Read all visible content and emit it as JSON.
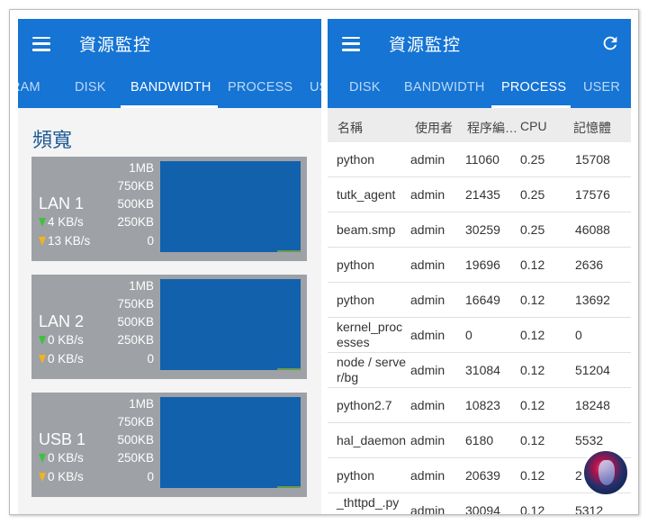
{
  "app": {
    "title": "資源監控"
  },
  "left": {
    "tabs": [
      "RAM",
      "DISK",
      "BANDWIDTH",
      "PROCESS",
      "USER"
    ],
    "active_tab": "BANDWIDTH",
    "section_title": "頻寬",
    "scale_labels": [
      "1MB",
      "750KB",
      "500KB",
      "250KB",
      "0"
    ],
    "interfaces": [
      {
        "name": "LAN 1",
        "upload": "4 KB/s",
        "download": "13 KB/s"
      },
      {
        "name": "LAN 2",
        "upload": "0 KB/s",
        "download": "0 KB/s"
      },
      {
        "name": "USB 1",
        "upload": "0 KB/s",
        "download": "0 KB/s"
      }
    ]
  },
  "right": {
    "tabs": [
      "DISK",
      "BANDWIDTH",
      "PROCESS",
      "USER"
    ],
    "active_tab": "PROCESS",
    "columns": [
      "名稱",
      "使用者",
      "程序編…",
      "CPU",
      "記憶體"
    ],
    "rows": [
      [
        "python",
        "admin",
        "11060",
        "0.25",
        "15708"
      ],
      [
        "tutk_agent",
        "admin",
        "21435",
        "0.25",
        "17576"
      ],
      [
        "beam.smp",
        "admin",
        "30259",
        "0.25",
        "46088"
      ],
      [
        "python",
        "admin",
        "19696",
        "0.12",
        "2636"
      ],
      [
        "python",
        "admin",
        "16649",
        "0.12",
        "13692"
      ],
      [
        "kernel_processes",
        "admin",
        "0",
        "0.12",
        "0"
      ],
      [
        "node / server/bg",
        "admin",
        "31084",
        "0.12",
        "51204"
      ],
      [
        "python2.7",
        "admin",
        "10823",
        "0.12",
        "18248"
      ],
      [
        "hal_daemon",
        "admin",
        "6180",
        "0.12",
        "5532"
      ],
      [
        "python",
        "admin",
        "20639",
        "0.12",
        "2"
      ],
      [
        "_thttpd_.py",
        "admin",
        "30094",
        "0.12",
        "5312"
      ]
    ]
  },
  "colors": {
    "primary": "#1574d4",
    "graph": "#1161ad",
    "card": "#9ea1a6",
    "upload_arrow": "#3cc23c",
    "download_arrow": "#f2b31f"
  }
}
